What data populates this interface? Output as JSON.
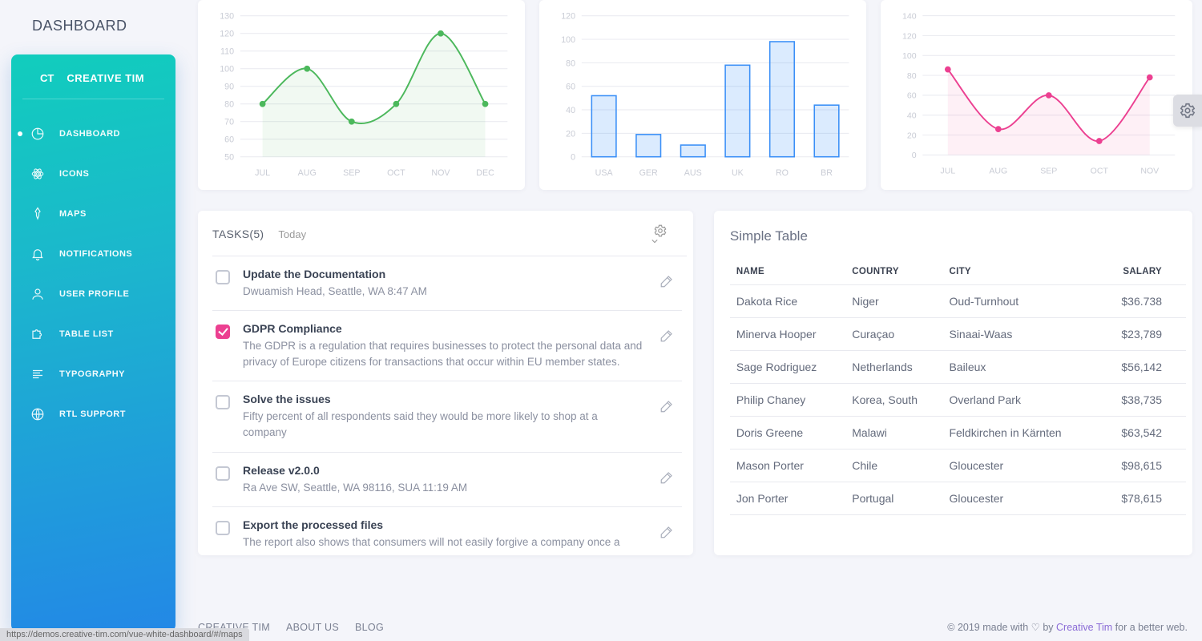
{
  "header": {
    "title": "DASHBOARD"
  },
  "brand": {
    "short": "CT",
    "name": "CREATIVE TIM"
  },
  "sidebar": {
    "items": [
      {
        "label": "DASHBOARD",
        "icon": "pie",
        "active": true
      },
      {
        "label": "ICONS",
        "icon": "atom",
        "active": false
      },
      {
        "label": "MAPS",
        "icon": "pin",
        "active": false
      },
      {
        "label": "NOTIFICATIONS",
        "icon": "bell",
        "active": false
      },
      {
        "label": "USER PROFILE",
        "icon": "user",
        "active": false
      },
      {
        "label": "TABLE LIST",
        "icon": "puzzle",
        "active": false
      },
      {
        "label": "TYPOGRAPHY",
        "icon": "align",
        "active": false
      },
      {
        "label": "RTL SUPPORT",
        "icon": "globe",
        "active": false
      }
    ]
  },
  "tasks": {
    "title": "TASKS(5)",
    "subtitle": "Today",
    "items": [
      {
        "title": "Update the Documentation",
        "sub": "Dwuamish Head, Seattle, WA 8:47 AM",
        "checked": false
      },
      {
        "title": "GDPR Compliance",
        "sub": "The GDPR is a regulation that requires businesses to protect the personal data and privacy of Europe citizens for transactions that occur within EU member states.",
        "checked": true
      },
      {
        "title": "Solve the issues",
        "sub": "Fifty percent of all respondents said they would be more likely to shop at a company",
        "checked": false
      },
      {
        "title": "Release v2.0.0",
        "sub": "Ra Ave SW, Seattle, WA 98116, SUA 11:19 AM",
        "checked": false
      },
      {
        "title": "Export the processed files",
        "sub": "The report also shows that consumers will not easily forgive a company once a breach exposing their personal data occurs.",
        "checked": false
      }
    ]
  },
  "table": {
    "title": "Simple Table",
    "columns": [
      "NAME",
      "COUNTRY",
      "CITY",
      "SALARY"
    ],
    "rows": [
      [
        "Dakota Rice",
        "Niger",
        "Oud-Turnhout",
        "$36.738"
      ],
      [
        "Minerva Hooper",
        "Curaçao",
        "Sinaai-Waas",
        "$23,789"
      ],
      [
        "Sage Rodriguez",
        "Netherlands",
        "Baileux",
        "$56,142"
      ],
      [
        "Philip Chaney",
        "Korea, South",
        "Overland Park",
        "$38,735"
      ],
      [
        "Doris Greene",
        "Malawi",
        "Feldkirchen in Kärnten",
        "$63,542"
      ],
      [
        "Mason Porter",
        "Chile",
        "Gloucester",
        "$98,615"
      ],
      [
        "Jon Porter",
        "Portugal",
        "Gloucester",
        "$78,615"
      ]
    ]
  },
  "footer": {
    "links": [
      "CREATIVE TIM",
      "ABOUT US",
      "BLOG"
    ],
    "copyright_prefix": "© 2019 made with ♡ by ",
    "copyright_link": "Creative Tim",
    "copyright_suffix": " for a better web."
  },
  "url_hint": "https://demos.creative-tim.com/vue-white-dashboard/#/maps",
  "chart_data": [
    {
      "type": "line",
      "color": "#4cb85c",
      "categories": [
        "JUL",
        "AUG",
        "SEP",
        "OCT",
        "NOV",
        "DEC"
      ],
      "values": [
        80,
        100,
        70,
        80,
        120,
        80
      ],
      "ylim": [
        50,
        130
      ],
      "ystep": 10
    },
    {
      "type": "bar",
      "color": "#3a8ff7",
      "categories": [
        "USA",
        "GER",
        "AUS",
        "UK",
        "RO",
        "BR"
      ],
      "values": [
        52,
        19,
        10,
        78,
        98,
        44
      ],
      "ylim": [
        0,
        120
      ],
      "ystep": 20
    },
    {
      "type": "line",
      "color": "#ec4091",
      "categories": [
        "JUL",
        "AUG",
        "SEP",
        "OCT",
        "NOV"
      ],
      "values": [
        86,
        26,
        60,
        14,
        78
      ],
      "ylim": [
        0,
        140
      ],
      "ystep": 20
    }
  ]
}
